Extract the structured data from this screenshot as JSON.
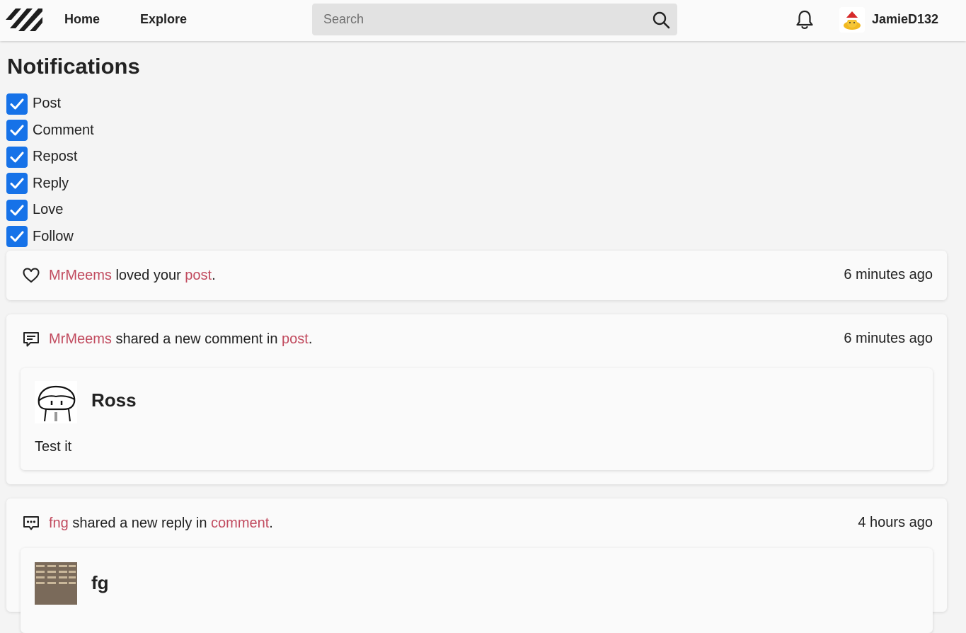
{
  "header": {
    "nav": {
      "home": "Home",
      "explore": "Explore"
    },
    "search": {
      "placeholder": "Search",
      "value": ""
    },
    "username": "JamieD132"
  },
  "page": {
    "title": "Notifications"
  },
  "filters": [
    {
      "label": "Post",
      "checked": true
    },
    {
      "label": "Comment",
      "checked": true
    },
    {
      "label": "Repost",
      "checked": true
    },
    {
      "label": "Reply",
      "checked": true
    },
    {
      "label": "Love",
      "checked": true
    },
    {
      "label": "Follow",
      "checked": true
    }
  ],
  "notifications": [
    {
      "icon": "heart-icon",
      "actor": "MrMeems",
      "text": " loved your ",
      "target": "post",
      "end": ".",
      "time": "6 minutes ago"
    },
    {
      "icon": "comment-icon",
      "actor": "MrMeems",
      "text": " shared a new comment in ",
      "target": "post",
      "end": ".",
      "time": "6 minutes ago",
      "content": {
        "author": "Ross",
        "body": "Test it"
      }
    },
    {
      "icon": "reply-icon",
      "actor": "fng",
      "text": " shared a new reply in ",
      "target": "comment",
      "end": ".",
      "time": "4 hours ago",
      "content": {
        "author": "fg",
        "body": ""
      }
    }
  ],
  "colors": {
    "accent": "#c14a5e",
    "checkbox": "#1672e8"
  }
}
